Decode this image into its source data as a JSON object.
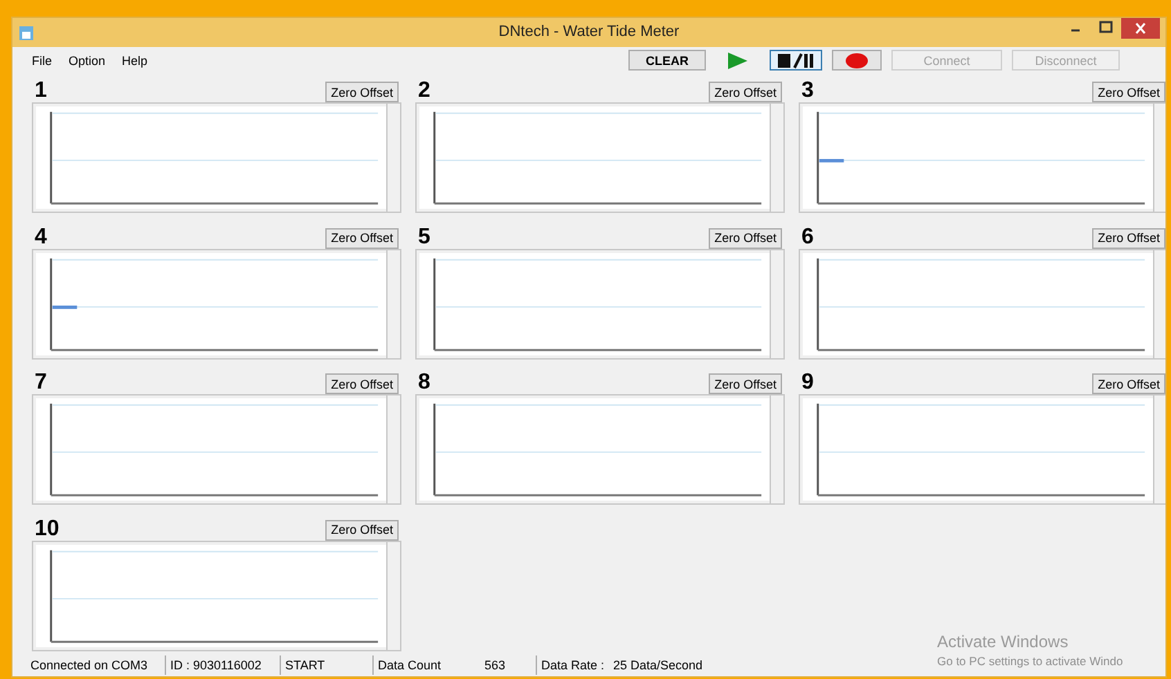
{
  "window": {
    "title": "DNtech - Water Tide Meter"
  },
  "menu": [
    "File",
    "Option",
    "Help"
  ],
  "toolbar": [
    {
      "kind": "text",
      "label": "CLEAR",
      "disabled": false,
      "selected": false
    },
    {
      "kind": "play",
      "disabled": false,
      "selected": false
    },
    {
      "kind": "stop-pause",
      "disabled": false,
      "selected": true
    },
    {
      "kind": "record",
      "disabled": false,
      "selected": false
    },
    {
      "kind": "text",
      "label": "Connect",
      "disabled": true,
      "selected": false
    },
    {
      "kind": "text",
      "label": "Disconnect",
      "disabled": true,
      "selected": false
    }
  ],
  "meters": [
    {
      "number": "1",
      "button": "Zero Offset",
      "trace": false
    },
    {
      "number": "2",
      "button": "Zero Offset",
      "trace": false
    },
    {
      "number": "3",
      "button": "Zero Offset",
      "trace": true
    },
    {
      "number": "4",
      "button": "Zero Offset",
      "trace": true
    },
    {
      "number": "5",
      "button": "Zero Offset",
      "trace": false
    },
    {
      "number": "6",
      "button": "Zero Offset",
      "trace": false
    },
    {
      "number": "7",
      "button": "Zero Offset",
      "trace": false
    },
    {
      "number": "8",
      "button": "Zero Offset",
      "trace": false
    },
    {
      "number": "9",
      "button": "Zero Offset",
      "trace": false
    },
    {
      "number": "10",
      "button": "Zero Offset",
      "trace": false
    }
  ],
  "status_bar": [
    "Connected on COM3",
    "ID : 9030116002",
    "START",
    "Data Count",
    "563",
    "Data Rate :",
    "25 Data/Second"
  ],
  "activation_notice": {
    "title": "Activate Windows",
    "text": "Go to PC settings to activate Windo"
  }
}
